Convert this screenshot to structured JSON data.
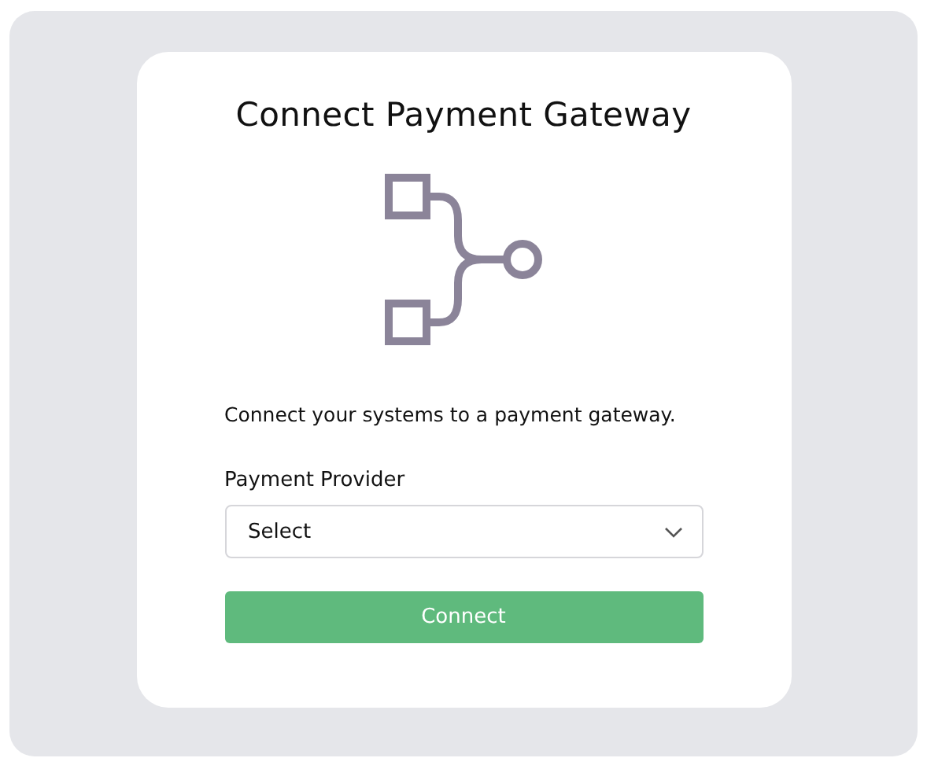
{
  "card": {
    "title": "Connect Payment Gateway",
    "description": "Connect your systems to a payment gateway.",
    "field": {
      "label": "Payment Provider",
      "value": "Select"
    },
    "button": {
      "label": "Connect"
    }
  }
}
